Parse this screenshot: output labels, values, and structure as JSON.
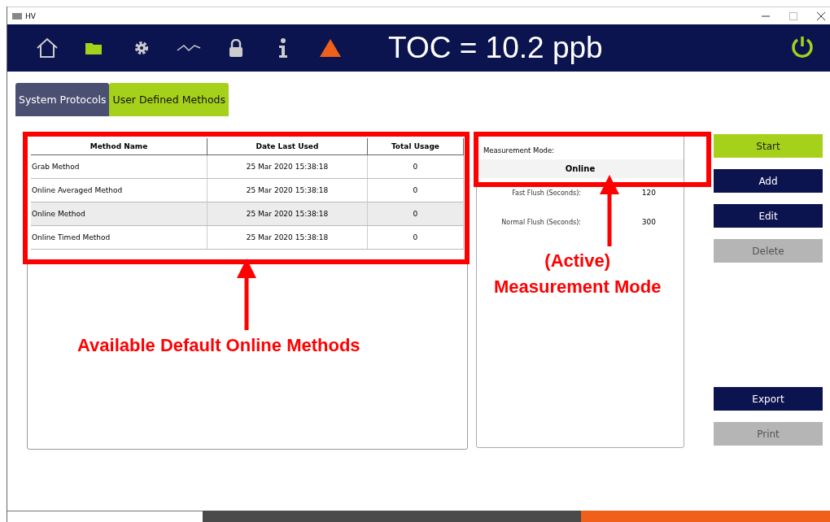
{
  "window": {
    "title": "HV"
  },
  "toolbar": {
    "icons": [
      {
        "kind": "home",
        "selected": false
      },
      {
        "kind": "folder",
        "selected": true
      },
      {
        "kind": "gear",
        "selected": false
      },
      {
        "kind": "graph",
        "selected": false
      },
      {
        "kind": "lock",
        "selected": false
      },
      {
        "kind": "info",
        "selected": false
      },
      {
        "kind": "warning",
        "selected": false
      }
    ],
    "reading": "TOC = 10.2 ppb"
  },
  "tabs": [
    {
      "label": "System Protocols",
      "selected": false
    },
    {
      "label": "User Defined Methods",
      "selected": true
    }
  ],
  "table": {
    "columns": [
      "Method Name",
      "Date Last Used",
      "Total Usage"
    ],
    "rows": [
      {
        "cells": [
          "Grab Method",
          "25 Mar 2020 15:38:18",
          "0"
        ],
        "selected": false
      },
      {
        "cells": [
          "Online Averaged Method",
          "25 Mar 2020 15:38:18",
          "0"
        ],
        "selected": false
      },
      {
        "cells": [
          "Online Method",
          "25 Mar 2020 15:38:18",
          "0"
        ],
        "selected": true
      },
      {
        "cells": [
          "Online Timed Method",
          "25 Mar 2020 15:38:18",
          "0"
        ],
        "selected": false
      }
    ]
  },
  "details": {
    "mode_label": "Measurement Mode:",
    "mode_value": "Online",
    "fields": [
      {
        "label": "Fast Flush (Seconds):",
        "value": "120"
      },
      {
        "label": "Normal Flush (Seconds):",
        "value": "300"
      }
    ]
  },
  "buttons": [
    {
      "label": "Start",
      "kind": "primary",
      "disabled": false
    },
    {
      "label": "Add",
      "kind": "dark",
      "disabled": false
    },
    {
      "label": "Edit",
      "kind": "dark",
      "disabled": false
    },
    {
      "label": "Delete",
      "kind": "dark",
      "disabled": true
    }
  ],
  "lower_buttons": [
    {
      "label": "Export",
      "disabled": false
    },
    {
      "label": "Print",
      "disabled": true
    }
  ],
  "annotations": [
    {
      "text": "Available Default Online Methods"
    },
    {
      "text": "(Active)\nMeasurement Mode"
    }
  ]
}
